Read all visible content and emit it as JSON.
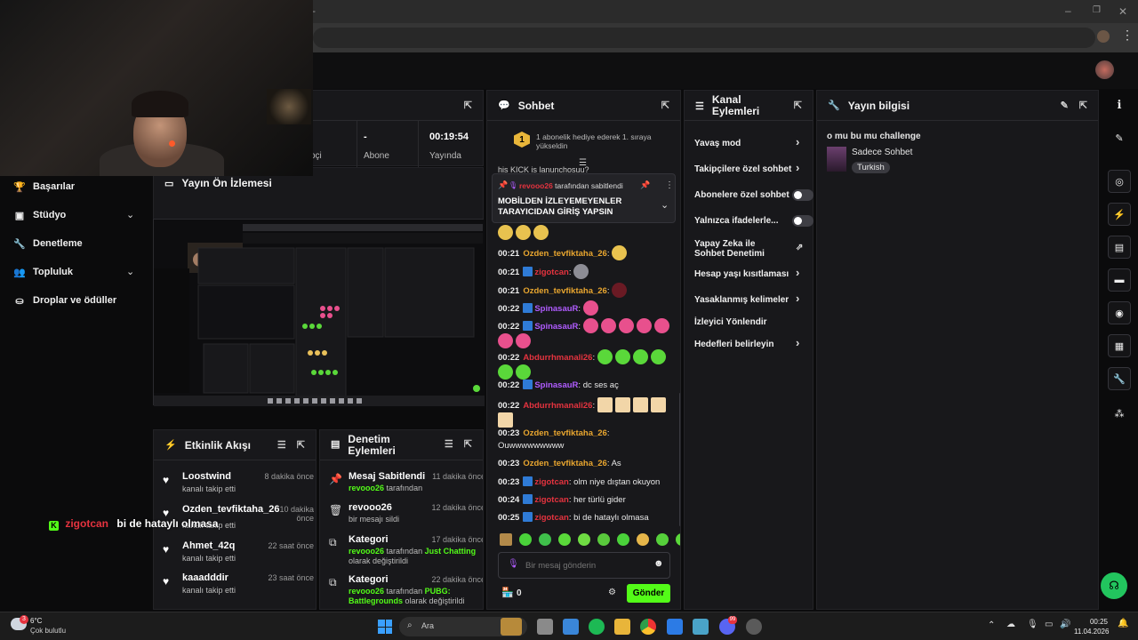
{
  "browser": {
    "new_tab": "+",
    "minimize": "–",
    "restore": "❐",
    "close": "✕",
    "star": "☆",
    "menu": "⋮"
  },
  "sidebar": {
    "items": [
      {
        "label": "Başarılar",
        "icon": "trophy-icon"
      },
      {
        "label": "Stüdyo",
        "icon": "studio-icon",
        "expandable": true
      },
      {
        "label": "Denetleme",
        "icon": "wrench-icon"
      },
      {
        "label": "Topluluk",
        "icon": "community-icon",
        "expandable": true
      },
      {
        "label": "Droplar ve ödüller",
        "icon": "drops-icon"
      }
    ]
  },
  "stream_stats": {
    "partial_label": "oçi",
    "abone": {
      "value": "-",
      "label": "Abone"
    },
    "yayinda": {
      "value": "00:19:54",
      "label": "Yayında"
    }
  },
  "preview": {
    "title": "Yayın Ön İzlemesi"
  },
  "overlay_chat": {
    "user": "zigotcan",
    "message": "bi de hataylı olmasa"
  },
  "activity": {
    "title": "Etkinlik Akışı",
    "items": [
      {
        "name": "Loostwind",
        "sub": "kanalı takip etti",
        "time": "8 dakika önce"
      },
      {
        "name": "Ozden_tevfiktaha_26",
        "sub": "kanalı takip etti",
        "time": "10 dakika önce"
      },
      {
        "name": "Ahmet_42q",
        "sub": "kanalı takip etti",
        "time": "22 saat önce"
      },
      {
        "name": "kaaadddir",
        "sub": "kanalı takip etti",
        "time": "23 saat önce"
      }
    ]
  },
  "mod": {
    "title": "Denetim Eylemleri",
    "items": [
      {
        "name": "Mesaj Sabitlendi",
        "time": "11 dakika önce",
        "user": "revooo26",
        "sub": "tarafından",
        "icon": "pin-icon"
      },
      {
        "name": "revooo26",
        "time": "12 dakika önce",
        "sub": "bir mesajı sildi",
        "icon": "trash-icon"
      },
      {
        "name": "Kategori",
        "time": "17 dakika önce",
        "user": "revooo26",
        "sub": "tarafından",
        "cat": "Just Chatting",
        "sub2": "olarak değiştirildi",
        "icon": "category-icon"
      },
      {
        "name": "Kategori",
        "time": "22 dakika önce",
        "user": "revooo26",
        "sub": "tarafından",
        "cat": "PUBG: Battlegrounds",
        "sub2": "olarak değiştirildi",
        "icon": "category-icon"
      }
    ]
  },
  "chat": {
    "title": "Sohbet",
    "gift_rank": "1",
    "gift_text": "1 abonelik hediye ederek 1. sıraya yükseldin",
    "pinned_by": "revooo26",
    "pinned_suffix": "tarafından sabitlendi",
    "pinned_msg": "MOBİLDEN İZLEYEMEYENLER TARAYICIDAN GİRİŞ YAPSIN",
    "partial_top": "his KICK is lanunchosuu?",
    "lines": [
      {
        "ts": "00:21",
        "user": "Ozden_tevfiktaha_26",
        "color": "#e9a62f",
        "badge": false,
        "msg": ":"
      },
      {
        "ts": "00:21",
        "user": "zigotcan",
        "color": "#e5333f",
        "badge": true,
        "msg": ":"
      },
      {
        "ts": "00:21",
        "user": "Ozden_tevfiktaha_26",
        "color": "#e9a62f",
        "badge": false,
        "msg": ":"
      },
      {
        "ts": "00:22",
        "user": "SpinasauR",
        "color": "#b05cff",
        "badge": true,
        "msg": ":"
      },
      {
        "ts": "00:22",
        "user": "SpinasauR",
        "color": "#b05cff",
        "badge": true,
        "msg": ":"
      },
      {
        "ts": "00:22",
        "user": "Abdurrhmanali26",
        "color": "#e5333f",
        "badge": false,
        "msg": ":"
      },
      {
        "ts": "00:22",
        "user": "SpinasauR",
        "color": "#b05cff",
        "badge": true,
        "msg": ": dc ses aç"
      },
      {
        "ts": "00:22",
        "user": "Abdurrhmanali26",
        "color": "#e5333f",
        "badge": false,
        "msg": ":"
      },
      {
        "ts": "00:23",
        "user": "Ozden_tevfiktaha_26",
        "color": "#e9a62f",
        "badge": false,
        "msg": ":"
      },
      {
        "ts": "",
        "user": "",
        "color": "#e8e8e8",
        "badge": false,
        "msg": "Ouwwwwwwwww"
      },
      {
        "ts": "00:23",
        "user": "Ozden_tevfiktaha_26",
        "color": "#e9a62f",
        "badge": false,
        "msg": ": As"
      },
      {
        "ts": "00:23",
        "user": "zigotcan",
        "color": "#e5333f",
        "badge": true,
        "msg": ": olm niye dıştan okuyon"
      },
      {
        "ts": "00:24",
        "user": "zigotcan",
        "color": "#e5333f",
        "badge": true,
        "msg": ": her türlü gider"
      },
      {
        "ts": "00:25",
        "user": "zigotcan",
        "color": "#e5333f",
        "badge": true,
        "msg": ": bi de hataylı olmasa"
      }
    ],
    "input_placeholder": "Bir mesaj gönderin",
    "points": "0",
    "send_label": "Gönder"
  },
  "channel_actions": {
    "title": "Kanal Eylemleri",
    "items": [
      {
        "label": "Yavaş mod",
        "type": "arrow"
      },
      {
        "label": "Takipçilere özel sohbet",
        "type": "arrow"
      },
      {
        "label": "Abonelere özel sohbet",
        "type": "toggle"
      },
      {
        "label": "Yalnızca ifadelerle...",
        "type": "toggle"
      },
      {
        "label": "Yapay Zeka ile Sohbet Denetimi",
        "type": "external"
      },
      {
        "label": "Hesap yaşı kısıtlaması",
        "type": "arrow"
      },
      {
        "label": "Yasaklanmış kelimeler",
        "type": "arrow"
      },
      {
        "label": "İzleyici Yönlendir",
        "type": "none"
      },
      {
        "label": "Hedefleri belirleyin",
        "type": "arrow"
      }
    ]
  },
  "stream_info": {
    "title": "Yayın bilgisi",
    "stream_title": "o mu bu mu challenge",
    "category": "Sadece Sohbet",
    "language": "Turkish"
  },
  "taskbar": {
    "temp": "6°C",
    "weather": "Çok bulutlu",
    "weather_badge": "3",
    "search": "Ara",
    "time": "00:25",
    "date": "11.04.2026",
    "discord_badge": "99"
  },
  "colors": {
    "accent": "#53fc18",
    "panel": "#18181b",
    "bg": "#0b0b0c"
  }
}
